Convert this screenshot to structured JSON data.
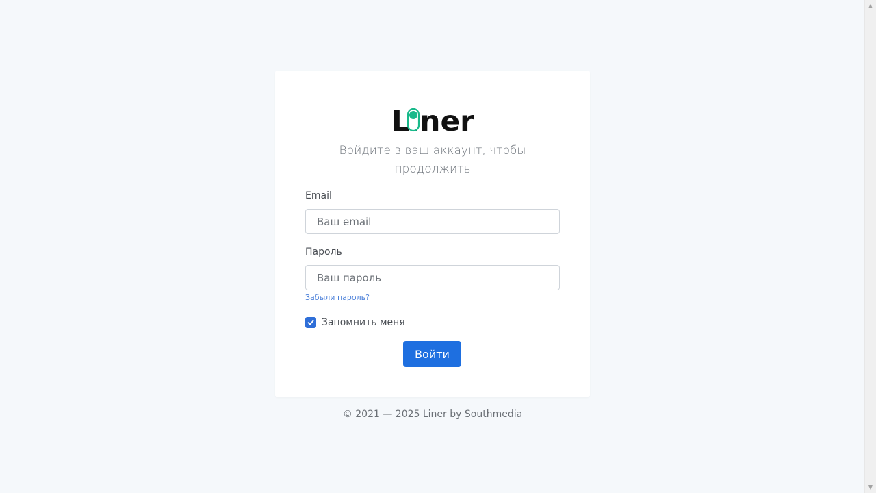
{
  "brand": {
    "logo_text": "Liner",
    "logo_color": "#111111",
    "logo_accent_color": "#18b98a"
  },
  "login": {
    "subtitle": "Войдите в ваш аккаунт, чтобы продолжить",
    "email_label": "Email",
    "email_placeholder": "Ваш email",
    "email_value": "",
    "password_label": "Пароль",
    "password_placeholder": "Ваш пароль",
    "password_value": "",
    "forgot_link": "Забыли пароль?",
    "remember_label": "Запомнить меня",
    "remember_checked": true,
    "submit_label": "Войти"
  },
  "footer": {
    "text": "© 2021 — 2025 Liner by Southmedia"
  },
  "colors": {
    "background": "#f5f8fb",
    "card": "#ffffff",
    "primary_button": "#1e6fe0",
    "link": "#4a7fd9",
    "checkbox": "#2f6fd8"
  },
  "icons": {
    "checkbox_check": "check-icon",
    "scroll_up": "scroll-up-arrow-icon",
    "scroll_down": "scroll-down-arrow-icon"
  }
}
